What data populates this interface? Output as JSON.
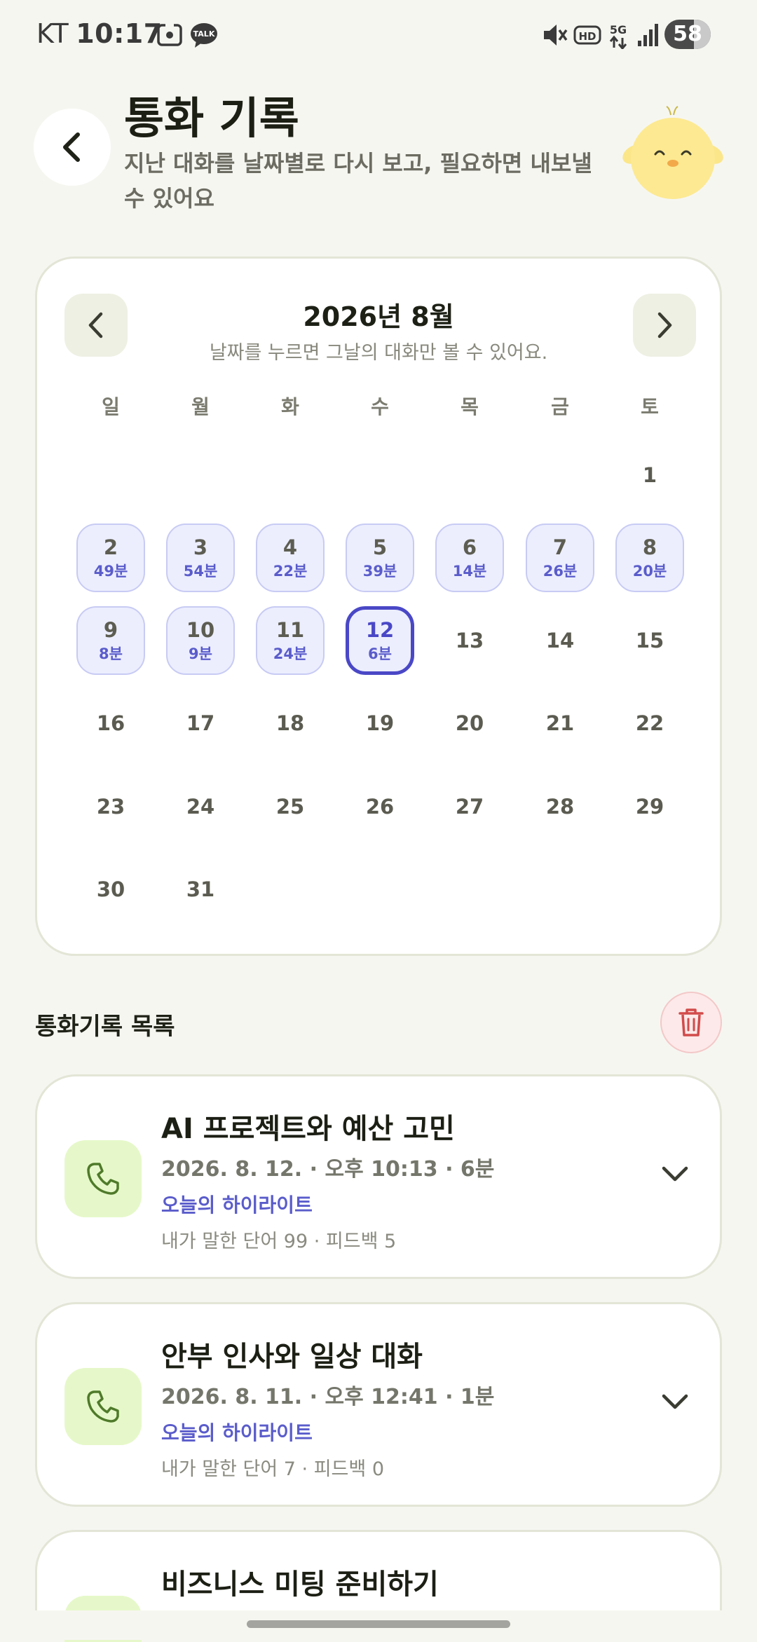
{
  "status_bar": {
    "carrier": "KT",
    "time": "10:17",
    "battery": "58",
    "icons": [
      "screenshot-icon",
      "kakaotalk-icon",
      "mute-icon",
      "hd-icon",
      "5g-icon",
      "signal-icon",
      "battery-icon"
    ],
    "talk_badge": "TALK",
    "hd_badge": "HD",
    "net_badge": "5G"
  },
  "header": {
    "title": "통화 기록",
    "subtitle": "지난 대화를 날짜별로 다시 보고, 필요하면 내보낼 수 있어요"
  },
  "calendar": {
    "month_label": "2026년 8월",
    "hint": "날짜를 누르면 그날의 대화만 볼 수 있어요.",
    "weekdays": [
      "일",
      "월",
      "화",
      "수",
      "목",
      "금",
      "토"
    ],
    "days": [
      {
        "num": "1",
        "min": ""
      },
      {
        "num": "2",
        "min": "49분"
      },
      {
        "num": "3",
        "min": "54분"
      },
      {
        "num": "4",
        "min": "22분"
      },
      {
        "num": "5",
        "min": "39분"
      },
      {
        "num": "6",
        "min": "14분"
      },
      {
        "num": "7",
        "min": "26분"
      },
      {
        "num": "8",
        "min": "20분"
      },
      {
        "num": "9",
        "min": "8분"
      },
      {
        "num": "10",
        "min": "9분"
      },
      {
        "num": "11",
        "min": "24분"
      },
      {
        "num": "12",
        "min": "6분"
      },
      {
        "num": "13",
        "min": ""
      },
      {
        "num": "14",
        "min": ""
      },
      {
        "num": "15",
        "min": ""
      },
      {
        "num": "16",
        "min": ""
      },
      {
        "num": "17",
        "min": ""
      },
      {
        "num": "18",
        "min": ""
      },
      {
        "num": "19",
        "min": ""
      },
      {
        "num": "20",
        "min": ""
      },
      {
        "num": "21",
        "min": ""
      },
      {
        "num": "22",
        "min": ""
      },
      {
        "num": "23",
        "min": ""
      },
      {
        "num": "24",
        "min": ""
      },
      {
        "num": "25",
        "min": ""
      },
      {
        "num": "26",
        "min": ""
      },
      {
        "num": "27",
        "min": ""
      },
      {
        "num": "28",
        "min": ""
      },
      {
        "num": "29",
        "min": ""
      },
      {
        "num": "30",
        "min": ""
      },
      {
        "num": "31",
        "min": ""
      }
    ],
    "selected_day": "12"
  },
  "list": {
    "title": "통화기록 목록",
    "records": [
      {
        "title": "AI 프로젝트와 예산 고민",
        "meta": "2026. 8. 12. · 오후 10:13 · 6분",
        "highlight": "오늘의 하이라이트",
        "stats": "내가 말한 단어 99 · 피드백 5"
      },
      {
        "title": "안부 인사와 일상 대화",
        "meta": "2026. 8. 11. · 오후 12:41 · 1분",
        "highlight": "오늘의 하이라이트",
        "stats": "내가 말한 단어 7 · 피드백 0"
      },
      {
        "title": "비즈니스 미팅 준비하기",
        "meta": "",
        "highlight": "",
        "stats": ""
      }
    ]
  },
  "colors": {
    "background": "#f6f6f1",
    "accent": "#4a48c6",
    "minutes": "#5a5ccb",
    "phone_tile": "#e6f8c9",
    "trash": "#d24b4b"
  }
}
